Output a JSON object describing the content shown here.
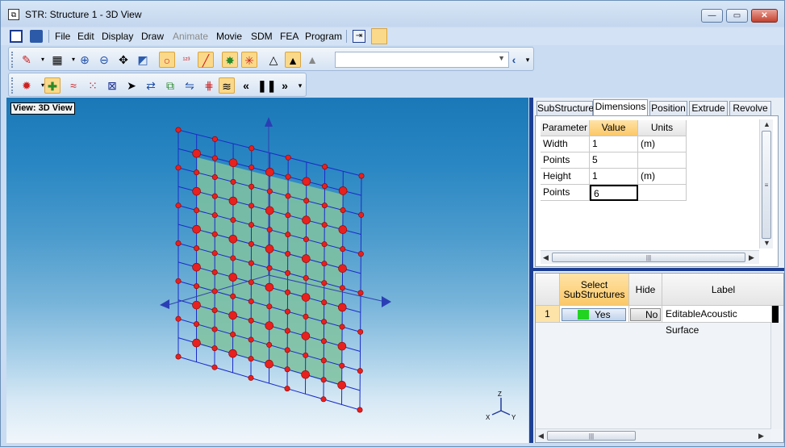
{
  "window": {
    "title": "STR: Structure 1 - 3D View"
  },
  "menu": {
    "items": [
      "File",
      "Edit",
      "Display",
      "Draw",
      "Animate",
      "Movie",
      "SDM",
      "FEA",
      "Program"
    ],
    "disabled": [
      "Animate"
    ]
  },
  "viewport": {
    "label": "View: 3D View",
    "axes": {
      "z": "Z",
      "x": "X",
      "y": "Y"
    }
  },
  "tabs": [
    "SubStructure",
    "Dimensions",
    "Position",
    "Extrude",
    "Revolve"
  ],
  "active_tab": "Dimensions",
  "dimensions": {
    "headers": [
      "Parameter",
      "Value",
      "Units"
    ],
    "rows": [
      {
        "parameter": "Width",
        "value": "1",
        "units": "(m)"
      },
      {
        "parameter": "Points",
        "value": "5",
        "units": ""
      },
      {
        "parameter": "Height",
        "value": "1",
        "units": "(m)"
      },
      {
        "parameter": "Points",
        "value": "6",
        "units": ""
      }
    ]
  },
  "substructures": {
    "headers": [
      "Select SubStructures",
      "Hide",
      "Label"
    ],
    "rows": [
      {
        "index": "1",
        "select": "Yes",
        "hide": "No",
        "label": "EditableAcoustic Surface"
      }
    ]
  },
  "colors": {
    "accent_splitter": "#1d3f93",
    "point_red": "#e8201e",
    "surface_green": "#7fc2a0",
    "grid_blue": "#1a2bc9"
  }
}
